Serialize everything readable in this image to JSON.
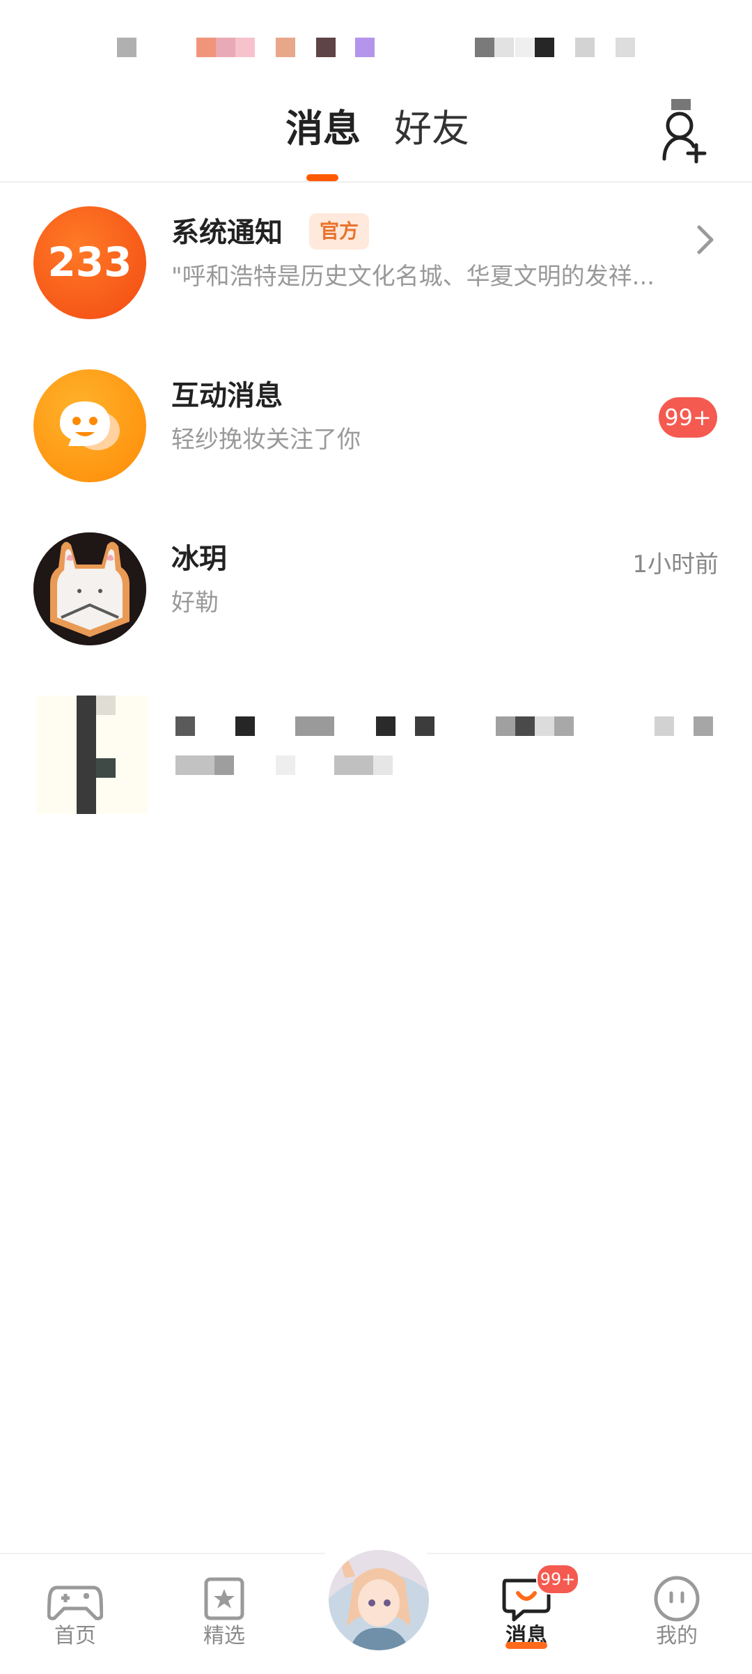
{
  "header": {
    "tabs": [
      {
        "label": "消息",
        "active": true
      },
      {
        "label": "好友",
        "active": false
      }
    ],
    "add_friend_icon": "add-person-icon",
    "accent_color": "#ff5a00"
  },
  "conversations": [
    {
      "name": "系统通知",
      "tag": "官方",
      "preview": "\"呼和浩特是历史文化名城、华夏文明的发祥...",
      "avatar_text": "233",
      "trailing": "chevron-right-icon"
    },
    {
      "name": "互动消息",
      "preview": "轻纱挽妆关注了你",
      "badge": "99+",
      "avatar_icon": "chat-bubble-face-icon"
    },
    {
      "name": "冰玥",
      "preview": "好勒",
      "time": "1小时前",
      "avatar_icon": "rabbit-toast-avatar"
    }
  ],
  "bottom_nav": [
    {
      "label": "首页",
      "icon": "gamepad-icon"
    },
    {
      "label": "精选",
      "icon": "star-card-icon"
    },
    {
      "label": "",
      "icon": "profile-avatar"
    },
    {
      "label": "消息",
      "icon": "chat-bubble-icon",
      "badge": "99+",
      "active": true
    },
    {
      "label": "我的",
      "icon": "face-icon"
    }
  ]
}
